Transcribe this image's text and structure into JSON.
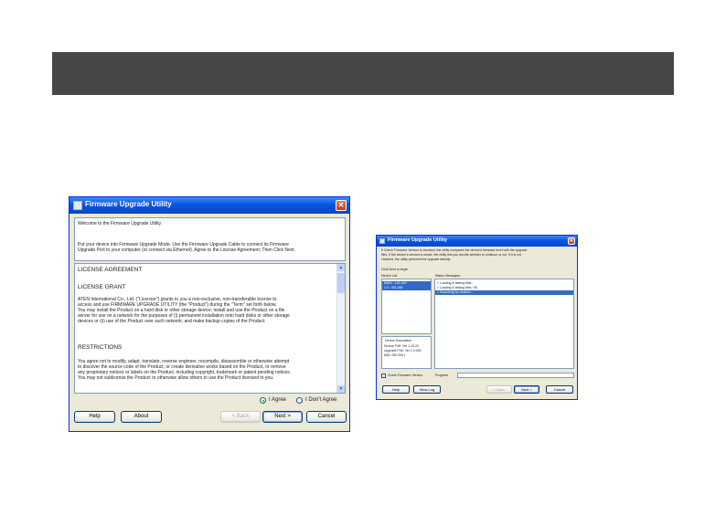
{
  "win1": {
    "title": "Firmware Upgrade Utility",
    "close_glyph": "✕",
    "intro": {
      "welcome": "Welcome to the Firmware Upgrade Utility.",
      "line1": "Put your device into Firmware Upgrade Mode. Use the Firmware Upgrade Cable to connect its Firmware",
      "line2": "Upgrade Port to your computer (or connect via Ethernet). Agree to the License Agreement; Then Click Next."
    },
    "license": {
      "heading": "LICENSE AGREEMENT",
      "grant_heading": "LICENSE GRANT",
      "grant_lines": [
        "ATEN International Co., Ltd. (\"Licensor\") grants to you a non-exclusive, non-transferable license to",
        "access and use FIRMWARE UPGRADE UTILITY (the \"Product\") during the \"Term\" set forth below.",
        "You may install the Product on a hard disk or other storage device; install and use the Product on a file",
        "server for use on a network for the purposes of (i) permanent installation onto hard disks or other storage",
        "devices or (ii) use of the Product over such network; and make backup copies of the Product."
      ],
      "restrictions_heading": "RESTRICTIONS",
      "restrictions_lines": [
        "You agree not to modify, adapt, translate, reverse engineer, recompile, disassemble or otherwise attempt",
        "to discover the source code of the Product, or create derivative works based on the Product, or remove",
        "any proprietary notices or labels on the Product, including copyright, trademark or patent pending notices.",
        "You may not sublicense the Product or otherwise allow others to use the Product licensed to you."
      ]
    },
    "agree_label": "I Agree",
    "disagree_label": "I Don't Agree",
    "buttons": {
      "help": "Help",
      "about": "About",
      "back": "< Back",
      "next": "Next >",
      "cancel": "Cancel"
    }
  },
  "win2": {
    "title": "Firmware Upgrade Utility",
    "close_glyph": "✕",
    "info_lines": [
      "If Check Firmware Version is checked, the utility compares the device's firmware level with the upgrade",
      "files. If the device's version is newer, the utility lets you decide whether to continue or not. If it is not",
      "checked, the utility performs the upgrade directly."
    ],
    "click_hint": "Click Next to begin.",
    "device_list_label": "Device List:",
    "devices": [
      "MAIN : 101-000",
      "1 0 : 301-000"
    ],
    "status_label": "Status Messages:",
    "status_messages": [
      "> Loading & testing files...",
      "> Loading & testing files: OK",
      "> Searching for devices..."
    ],
    "device_desc": {
      "heading": "Device Description",
      "lines": [
        "Device F/W: Ver 1.13.22",
        "Upgrade F/W: Ver 1.0.000",
        "MID: 000-0001"
      ]
    },
    "check_fw_label": "Check Firmware Version",
    "progress_label": "Progress",
    "buttons": {
      "help": "Help",
      "view_log": "View Log",
      "back": "< Back",
      "next": "Next >",
      "cancel": "Cancel"
    }
  }
}
